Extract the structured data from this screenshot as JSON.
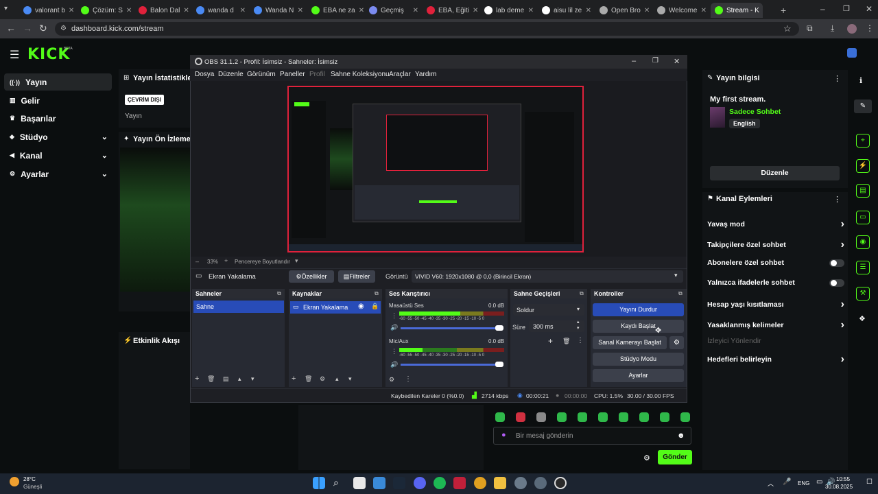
{
  "browser": {
    "tabs": [
      {
        "label": "valorant b",
        "color": "#4a8af4"
      },
      {
        "label": "Çözüm: S",
        "color": "#53fc18"
      },
      {
        "label": "Balon Dal",
        "color": "#e0213b"
      },
      {
        "label": "wanda d",
        "color": "#4a8af4"
      },
      {
        "label": "Wanda N",
        "color": "#4a8af4"
      },
      {
        "label": "EBA ne za",
        "color": "#53fc18"
      },
      {
        "label": "Geçmiş",
        "color": "#7b8bf0"
      },
      {
        "label": "EBA, Eğiti",
        "color": "#e0213b"
      },
      {
        "label": "lab deme",
        "color": "#ffffff"
      },
      {
        "label": "aisu lil ze",
        "color": "#ffffff"
      },
      {
        "label": "Open Bro",
        "color": "#aaaaaa"
      },
      {
        "label": "Welcome",
        "color": "#aaaaaa"
      },
      {
        "label": "Stream - K",
        "color": "#53fc18"
      }
    ],
    "url": "dashboard.kick.com/stream"
  },
  "kick": {
    "logo": "KICK",
    "beta": "BETA",
    "sidebar": [
      {
        "label": "Yayın",
        "icon": "broadcast-icon"
      },
      {
        "label": "Gelir",
        "icon": "chart-icon"
      },
      {
        "label": "Başarılar",
        "icon": "trophy-icon"
      },
      {
        "label": "Stüdyo",
        "icon": "studio-icon"
      },
      {
        "label": "Kanal",
        "icon": "megaphone-icon"
      },
      {
        "label": "Ayarlar",
        "icon": "gear-icon"
      }
    ],
    "stats_title": "Yayın İstatistikleri",
    "offline_badge": "ÇEVRİM DIŞI",
    "stats_sub": "Yayın",
    "preview_title": "Yayın Ön İzlemesi",
    "activity_title": "Etkinlik Akışı",
    "stream_info": {
      "title": "Yayın bilgisi",
      "stream_title": "My first stream.",
      "category": "Sadece Sohbet",
      "language": "English",
      "edit_button": "Düzenle"
    },
    "channel_actions": {
      "title": "Kanal Eylemleri",
      "rows": [
        {
          "label": "Yavaş mod",
          "type": "arrow"
        },
        {
          "label": "Takipçilere özel sohbet",
          "type": "arrow"
        },
        {
          "label": "Abonelere özel sohbet",
          "type": "toggle"
        },
        {
          "label": "Yalnızca ifadelerle sohbet",
          "type": "toggle"
        },
        {
          "label": "Hesap yaşı kısıtlaması",
          "type": "arrow"
        },
        {
          "label": "Yasaklanmış kelimeler",
          "type": "arrow"
        },
        {
          "label": "İzleyici Yönlendir",
          "type": "disabled"
        },
        {
          "label": "Hedefleri belirleyin",
          "type": "arrow"
        }
      ]
    },
    "chat": {
      "placeholder": "Bir mesaj gönderin",
      "send": "Gönder"
    }
  },
  "obs": {
    "title": "OBS 31.1.2 - Profil: İsimsiz - Sahneler: İsimsiz",
    "menu": [
      "Dosya",
      "Düzenle",
      "Görünüm",
      "Paneller",
      "Profil",
      "Sahne Koleksiyonu",
      "Araçlar",
      "Yardım"
    ],
    "zoom": "33%",
    "fit_label": "Pencereye Boyutlandır",
    "source_bar": {
      "name": "Ekran Yakalama",
      "properties": "Özellikler",
      "filters": "Filtreler",
      "display_label": "Görüntü",
      "display_value": "VIVID V60: 1920x1080 @ 0,0 (Birincil Ekran)"
    },
    "docks": {
      "scenes_title": "Sahneler",
      "scene_item": "Sahne",
      "sources_title": "Kaynaklar",
      "source_item": "Ekran Yakalama",
      "mixer_title": "Ses Karıştırıcı",
      "mixer_channels": [
        {
          "name": "Masaüstü Ses",
          "db": "0.0 dB",
          "level": 0.58
        },
        {
          "name": "Mic/Aux",
          "db": "0.0 dB",
          "level": 0.22
        }
      ],
      "meter_scale": "-60 -55 -50 -45 -40 -35 -30 -25 -20 -15 -10 -5 0",
      "transitions_title": "Sahne Geçişleri",
      "transition_value": "Soldur",
      "duration_label": "Süre",
      "duration_value": "300 ms",
      "controls_title": "Kontroller",
      "controls": [
        "Yayını Durdur",
        "Kaydı Başlat",
        "Sanal Kamerayı Başlat",
        "Stüdyo Modu",
        "Ayarlar"
      ]
    },
    "status": {
      "dropped": "Kaybedilen Kareler 0 (%0.0)",
      "bitrate": "2714 kbps",
      "stream_time": "00:00:21",
      "rec_time": "00:00:00",
      "cpu": "CPU: 1.5%",
      "fps": "30.00 / 30.00 FPS"
    }
  },
  "taskbar": {
    "weather_temp": "28°C",
    "weather_desc": "Güneşli",
    "lang": "ENG",
    "time": "10:55",
    "date": "30.08.2025"
  }
}
